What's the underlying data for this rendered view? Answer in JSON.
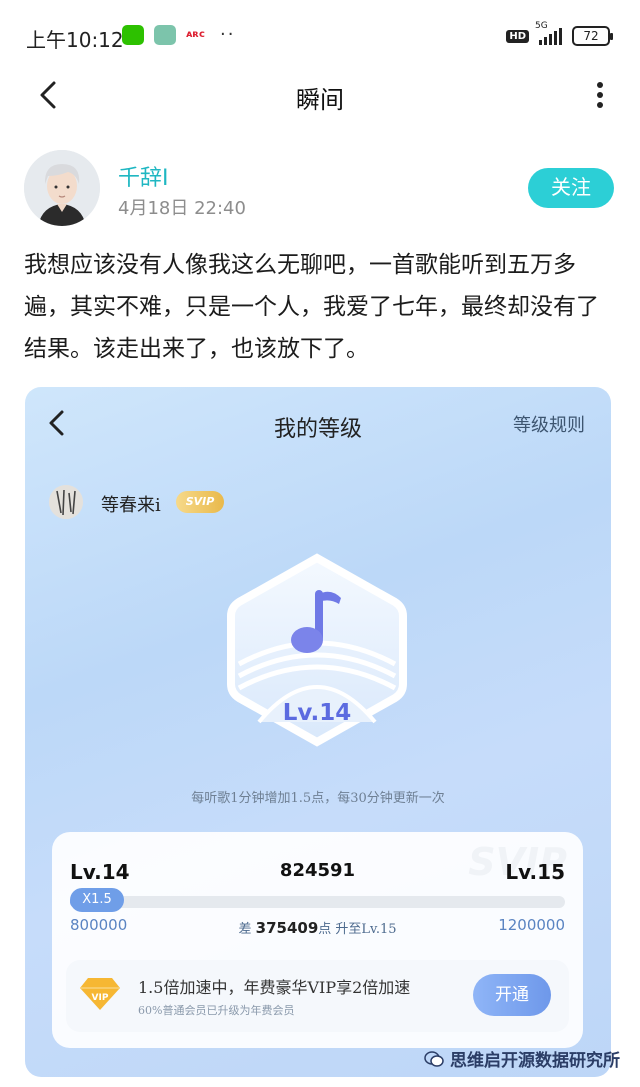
{
  "status_bar": {
    "time": "上午10:12",
    "red_app_text": "ᴀʀᴄ",
    "dots": "··",
    "hd": "HD",
    "network": "5G",
    "battery": "72"
  },
  "nav": {
    "title": "瞬间"
  },
  "post": {
    "author": "千辞I",
    "date": "4月18日 22:40",
    "follow_label": "关注",
    "text": "我想应该没有人像我这么无聊吧，一首歌能听到五万多遍，其实不难，只是一个人，我爱了七年，最终却没有了结果。该走出来了，也该放下了。"
  },
  "level_screen": {
    "title": "我的等级",
    "rules_label": "等级规则",
    "username": "等春来i",
    "badge": "SVIP",
    "level_label": "Lv.14",
    "hint": "每听歌1分钟增加1.5点，每30分钟更新一次",
    "progress": {
      "current_level": "Lv.14",
      "next_level": "Lv.15",
      "current_points": "824591",
      "min_points": "800000",
      "max_points": "1200000",
      "multiplier": "X1.5",
      "need_prefix": "差",
      "need_value": "375409",
      "need_suffix": "点 升至Lv.15",
      "watermark": "SVIP",
      "fraction": 0.06
    },
    "vip": {
      "title": "1.5倍加速中，年费豪华VIP享2倍加速",
      "subtitle": "60%普通会员已升级为年费会员",
      "button": "开通"
    }
  },
  "footer": {
    "source": "思维启开源数据研究所"
  },
  "colors": {
    "accent": "#2ccfd6",
    "author": "#1fb7c2",
    "level": "#5c6be0"
  }
}
